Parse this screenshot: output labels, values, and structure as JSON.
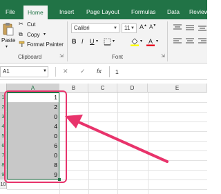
{
  "tabs": [
    "File",
    "Home",
    "Insert",
    "Page Layout",
    "Formulas",
    "Data",
    "Review"
  ],
  "active_tab": "Home",
  "clipboard": {
    "paste": "Paste",
    "cut": "Cut",
    "copy": "Copy",
    "format_painter": "Format Painter",
    "label": "Clipboard"
  },
  "font": {
    "name": "Calibri",
    "size": "11",
    "bold": "B",
    "italic": "I",
    "underline": "U",
    "label": "Font",
    "font_color": "#e81123",
    "fill_color": "#ffff00"
  },
  "formula_bar": {
    "name_box": "A1",
    "cancel": "✕",
    "enter": "✓",
    "fx": "fx",
    "value": "1"
  },
  "columns": [
    "A",
    "B",
    "C",
    "D",
    "E"
  ],
  "rows": [
    "1",
    "2",
    "3",
    "4",
    "5",
    "6",
    "7",
    "8",
    "9",
    "10"
  ],
  "cells": [
    "1",
    "2",
    "0",
    "4",
    "0",
    "6",
    "0",
    "8",
    "9"
  ],
  "accent": "#217346",
  "annotation_color": "#e8336b"
}
